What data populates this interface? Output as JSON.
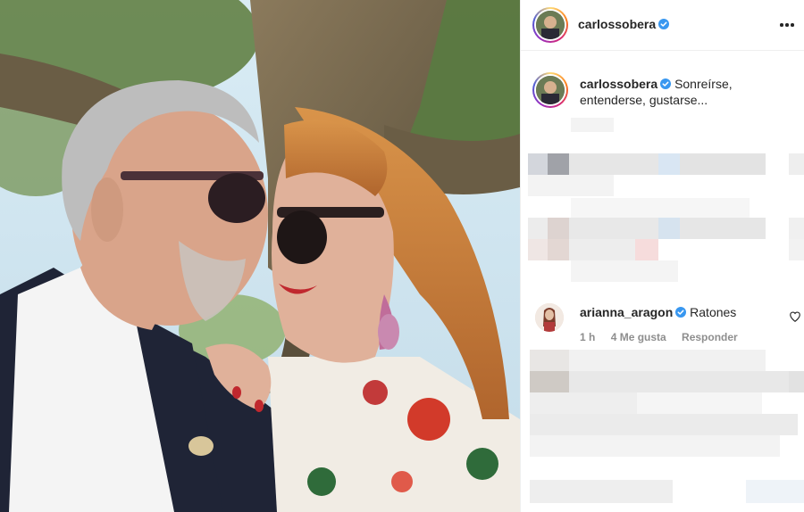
{
  "post": {
    "author": "carlossobera",
    "verified": true,
    "caption_text": "Sonreírse, entenderse, gustarse..."
  },
  "comments": [
    {
      "username": "arianna_aragon",
      "verified": true,
      "text": "Ratones",
      "time": "1 h",
      "likes": "4 Me gusta",
      "reply_label": "Responder"
    }
  ],
  "icons": {
    "verified": "verified-badge-icon",
    "more": "more-options-icon",
    "like": "heart-icon"
  },
  "colors": {
    "verified_blue": "#3897f0",
    "meta_gray": "#8e8e8e",
    "text": "#262626",
    "divider": "#efefef"
  }
}
